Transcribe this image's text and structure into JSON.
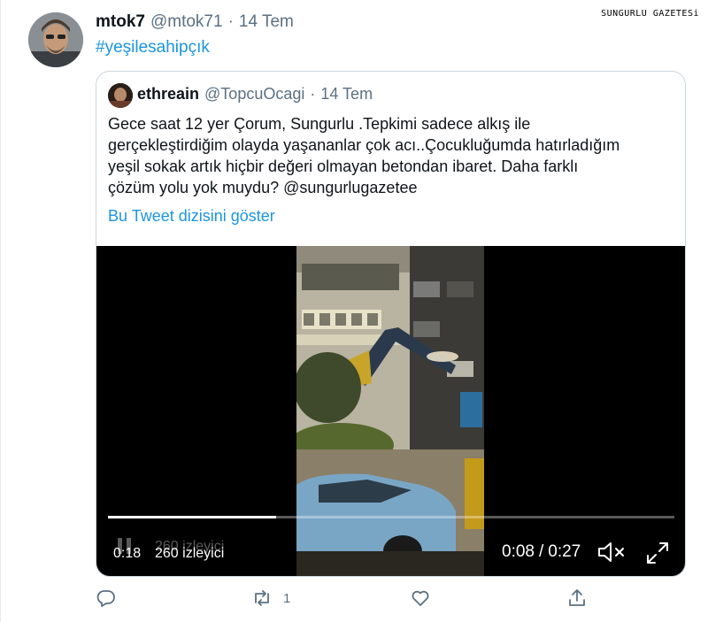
{
  "watermark": "SUNGURLU GAZETESi",
  "tweet": {
    "display_name": "mtok7",
    "handle": "@mtok71",
    "separator": "·",
    "date": "14 Tem",
    "hashtag": "#yeşilesahipçık",
    "avatar_icon": "user-avatar-photo"
  },
  "quote": {
    "display_name": "ethreain",
    "handle": "@TopcuOcagi",
    "separator": "·",
    "date": "14 Tem",
    "text_lines": [
      "Gece saat 12 yer Çorum, Sungurlu .Tepkimi sadece alkış ile",
      "gerçekleştirdiğim olayda yaşananlar çok acı..Çocukluğumda hatırladığım",
      "yeşil sokak artık hiçbir değeri olmayan betondan ibaret. Daha farklı",
      "çözüm yolu yok muydu? @sungurlugazetee"
    ],
    "show_thread": "Bu Tweet dizisini göster"
  },
  "video": {
    "current_time": "0:18",
    "views": "260 izleyici",
    "elapsed": "0:08",
    "time_sep": "/",
    "duration": "0:27",
    "progress_fraction": 0.297,
    "mute_icon": "mute-icon",
    "fullscreen_icon": "fullscreen-icon"
  },
  "actions": {
    "reply_icon": "reply-icon",
    "retweet_icon": "retweet-icon",
    "retweet_count": "1",
    "like_icon": "heart-icon",
    "share_icon": "share-icon"
  },
  "colors": {
    "link": "#1b95e0",
    "secondary_text": "#5b7083",
    "border": "#ccd6dd"
  }
}
